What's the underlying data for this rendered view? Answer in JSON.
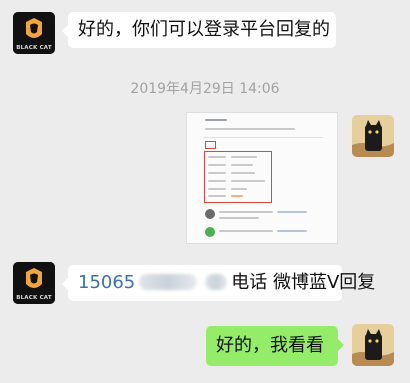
{
  "messages": {
    "msg1": {
      "text": "好的，你们可以登录平台回复的",
      "avatar": "black-cat-logo"
    },
    "timestamp": "2019年4月29日 14:06",
    "msg3": {
      "phone": "15065",
      "after": "电话  微博蓝V回复",
      "avatar": "black-cat-logo"
    },
    "msg4": {
      "text": "好的，我看看",
      "avatar": "cat-photo"
    }
  },
  "brand": {
    "logo_text": "BLACK CAT"
  },
  "colors": {
    "background": "#ececec",
    "bubble_left": "#ffffff",
    "bubble_right": "#95ec69",
    "timestamp": "#a2a2a2",
    "phone_link": "#3d6eb3",
    "highlight_box": "#e0473a"
  }
}
